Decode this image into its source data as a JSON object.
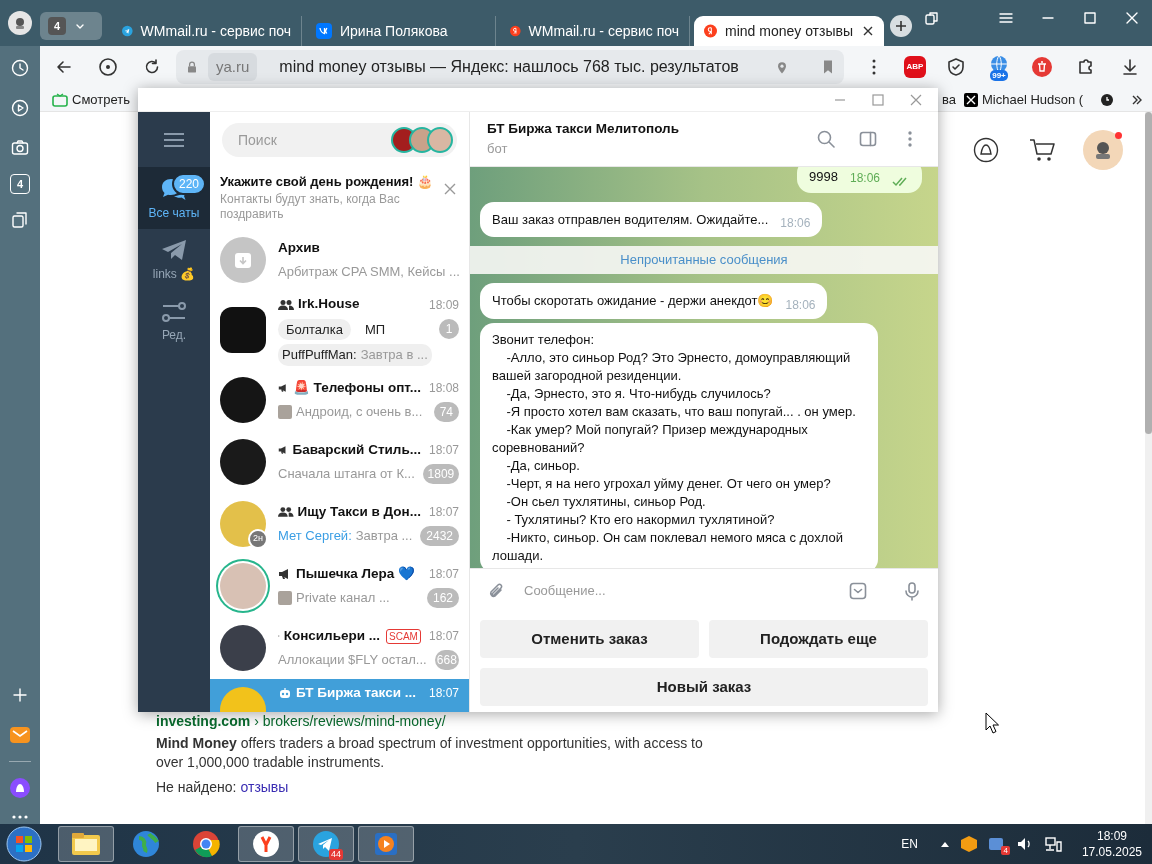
{
  "browser": {
    "tab_count": "4",
    "tabs": [
      {
        "label": "WMmail.ru - сервис поч",
        "kind": "telegram",
        "selected": false
      },
      {
        "label": "Ирина Полякова",
        "kind": "vk",
        "selected": false
      },
      {
        "label": "WMmail.ru - сервис поч",
        "kind": "yandex",
        "selected": false
      },
      {
        "label": "mind money отзывы",
        "kind": "yandex",
        "selected": true
      }
    ],
    "address": {
      "domain": "ya.ru",
      "title": "mind money отзывы — Яндекс: нашлось 768 тыс. результатов"
    },
    "extensions": [
      {
        "kind": "abp",
        "label": "ABP"
      },
      {
        "kind": "shield"
      },
      {
        "kind": "globe",
        "badge": "99+"
      },
      {
        "kind": "trash"
      },
      {
        "kind": "puzzle"
      }
    ],
    "bookmarks": [
      {
        "label": "Смотреть",
        "kind": "tv"
      },
      {
        "label": "ва"
      },
      {
        "label": "Michael Hudson (",
        "kind": "x"
      }
    ],
    "sidebar_tab_count": "4"
  },
  "telegram": {
    "search": {
      "placeholder": "Поиск"
    },
    "folders": [
      {
        "label": "Все чаты",
        "kind": "chats",
        "badge": "220",
        "selected": true
      },
      {
        "label": "links 💰",
        "kind": "plane",
        "selected": false
      },
      {
        "label": "Ред.",
        "kind": "sliders",
        "selected": false
      }
    ],
    "banner": {
      "title": "Укажите свой день рождения! 🎂",
      "text": "Контакты будут знать, когда Вас поздравить"
    },
    "chats": [
      {
        "kind": "archive",
        "name": "Архив",
        "preview": "Арбитраж CPA SMM, Кейсы ...",
        "selected": false
      },
      {
        "kind": "group",
        "name": "Irk.House",
        "time": "18:09",
        "topics": [
          "Болталка",
          "МП"
        ],
        "sender": "PuffPuffMan:",
        "preview": "Завтра в ...",
        "unread": "1",
        "selected": false
      },
      {
        "kind": "channel",
        "name": "🚨 Телефоны опт...",
        "time": "18:08",
        "thumbnail": true,
        "preview": "Андроид, с очень в...",
        "unread": "74",
        "selected": false
      },
      {
        "kind": "channel",
        "name": "Баварский Стиль...",
        "time": "18:07",
        "preview": "Сначала штанга от К...",
        "unread": "1809",
        "selected": false
      },
      {
        "kind": "group",
        "name": "Ищу Такси в Дон...",
        "time": "18:07",
        "avatar_badge": "2н",
        "sender": "Мет Сергей:",
        "preview": "Завтра ...",
        "unread": "2432",
        "selected": false
      },
      {
        "kind": "channel",
        "name": "Пышечка Лера 💙",
        "time": "18:07",
        "story": true,
        "thumbnail": true,
        "preview": "Private канал ...",
        "unread": "162",
        "selected": false
      },
      {
        "kind": "channel",
        "name": "Консильери ...",
        "tag": "SCAM",
        "time": "18:07",
        "preview": "Аллокации $FLY остал...",
        "unread": "668",
        "selected": false
      },
      {
        "kind": "bot",
        "name": "БТ Биржа такси ...",
        "time": "18:07",
        "selected": true
      }
    ],
    "chat": {
      "title": "БТ Биржа такси Мелитополь",
      "subtitle": "бот",
      "messages": [
        {
          "kind": "outgoing",
          "text": "9998",
          "time": "18:06",
          "read": true
        },
        {
          "kind": "incoming",
          "text": "Ваш заказ отправлен водителям. Ожидайте...",
          "time": "18:06"
        },
        {
          "kind": "divider",
          "text": "Непрочитанные сообщения"
        },
        {
          "kind": "incoming",
          "text": "Чтобы скоротать ожидание - держи анекдот😊",
          "time": "18:06"
        },
        {
          "kind": "long",
          "paragraphs": [
            "Звонит телефон:",
            "    -Алло, это синьор Род? Это Эрнесто, домоуправляющий вашей загородной резиденции.",
            "    -Да, Эрнесто, это я. Что-нибудь случилось?",
            "    -Я просто хотел вам сказать, что ваш попугай... . он умер.",
            "    -Как умер? Мой попугай? Призер международных соревнований?",
            "    -Да, синьор.",
            "    -Черт, я на него угрохал уйму денег. От чего он умер?",
            "    -Он сьел тухлятины, синьор Род.",
            "    - Тухлятины? Кто его накормил тухлятиной?",
            "    -Никто, синьор. Он сам поклевал немого мяса с дохлой лошади."
          ]
        }
      ],
      "input": {
        "placeholder": "Сообщение..."
      },
      "keyboard": [
        [
          "Отменить заказ",
          "Подождать еще"
        ],
        [
          "Новый заказ"
        ]
      ]
    }
  },
  "page": {
    "site": "investing.com",
    "path": "› brokers/reviews/mind-money/",
    "snippet": "**Mind Money** offers traders a broad spectrum of investment opportunities, with access to over 1,000,000 tradable instruments.",
    "missing_label": "Не найдено:",
    "missing_word": "отзывы"
  },
  "taskbar": {
    "apps": [
      {
        "kind": "explorer",
        "running": true
      },
      {
        "kind": "globe",
        "running": false
      },
      {
        "kind": "chrome",
        "running": false
      },
      {
        "kind": "yandex",
        "running": true
      },
      {
        "kind": "telegram",
        "running": true,
        "badge": "44"
      },
      {
        "kind": "media",
        "running": true
      }
    ],
    "language": "EN",
    "tray_badge": "4",
    "time": "18:09",
    "date": "17.05.2025"
  }
}
